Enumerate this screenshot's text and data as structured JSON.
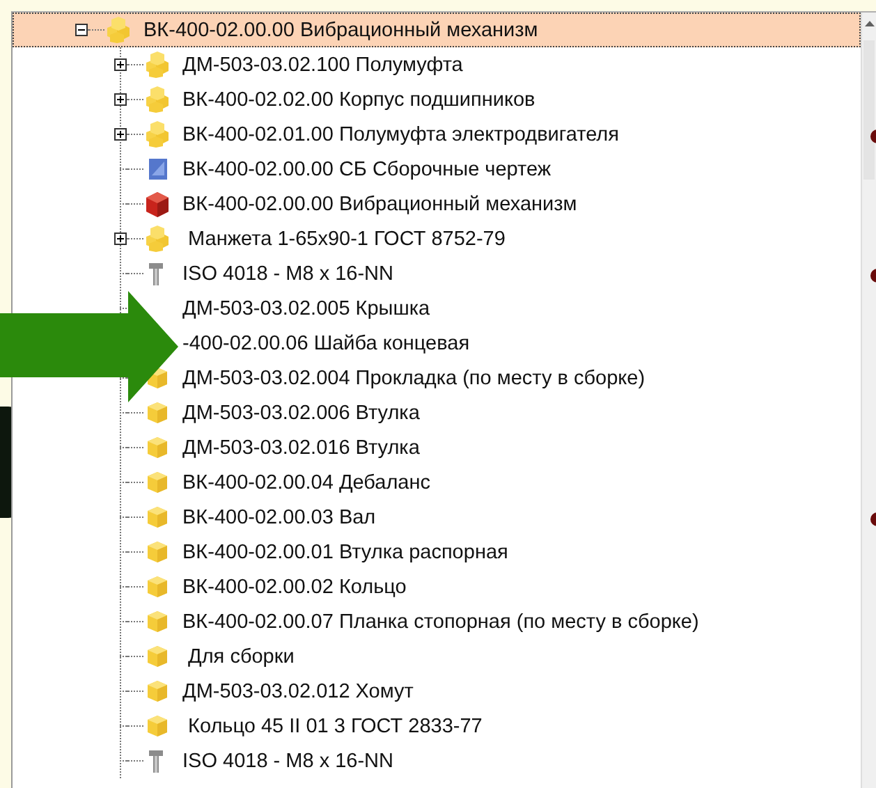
{
  "tree": {
    "label": "ВК-400-02.00.00 Вибрационный механизм",
    "kind": "assembly",
    "expanded": true,
    "selected": true,
    "children": [
      {
        "label": "ДМ-503-03.02.100 Полумуфта",
        "kind": "assembly",
        "expanded": false,
        "selected": false
      },
      {
        "label": "ВК-400-02.02.00 Корпус подшипников",
        "kind": "assembly",
        "expanded": false,
        "selected": false
      },
      {
        "label": "ВК-400-02.01.00 Полумуфта электродвигателя",
        "kind": "assembly",
        "expanded": false,
        "selected": false
      },
      {
        "label": "ВК-400-02.00.00 СБ Сборочные чертеж",
        "kind": "drawing",
        "selected": false
      },
      {
        "label": "ВК-400-02.00.00 Вибрационный механизм",
        "kind": "model",
        "selected": false
      },
      {
        "label": " Манжета 1-65x90-1 ГОСТ 8752-79",
        "kind": "assembly",
        "expanded": false,
        "selected": false
      },
      {
        "label": "ISO 4018 - M8 x 16-NN",
        "kind": "bolt",
        "selected": false
      },
      {
        "label": "ДМ-503-03.02.005 Крышка",
        "selected": false
      },
      {
        "label": "-400-02.00.06 Шайба концевая",
        "selected": false
      },
      {
        "label": "ДМ-503-03.02.004 Прокладка (по месту в сборке)",
        "kind": "part",
        "selected": false
      },
      {
        "label": "ДМ-503-03.02.006 Втулка",
        "kind": "part",
        "selected": false
      },
      {
        "label": "ДМ-503-03.02.016 Втулка",
        "kind": "part",
        "selected": false
      },
      {
        "label": "ВК-400-02.00.04 Дебаланс",
        "kind": "part",
        "selected": false
      },
      {
        "label": "ВК-400-02.00.03 Вал",
        "kind": "part",
        "selected": false
      },
      {
        "label": "ВК-400-02.00.01 Втулка распорная",
        "kind": "part",
        "selected": false
      },
      {
        "label": "ВК-400-02.00.02 Кольцо",
        "kind": "part",
        "selected": false
      },
      {
        "label": "ВК-400-02.00.07 Планка стопорная (по месту в сборке)",
        "kind": "part",
        "selected": false
      },
      {
        "label": " Для сборки",
        "kind": "part",
        "selected": false
      },
      {
        "label": "ДМ-503-03.02.012 Хомут",
        "kind": "part",
        "selected": false
      },
      {
        "label": " Кольцо 45 II 01 3 ГОСТ 2833-77",
        "kind": "part",
        "selected": false
      },
      {
        "label": "ISO 4018 - M8 x 16-NN",
        "kind": "bolt",
        "selected": false
      }
    ]
  }
}
